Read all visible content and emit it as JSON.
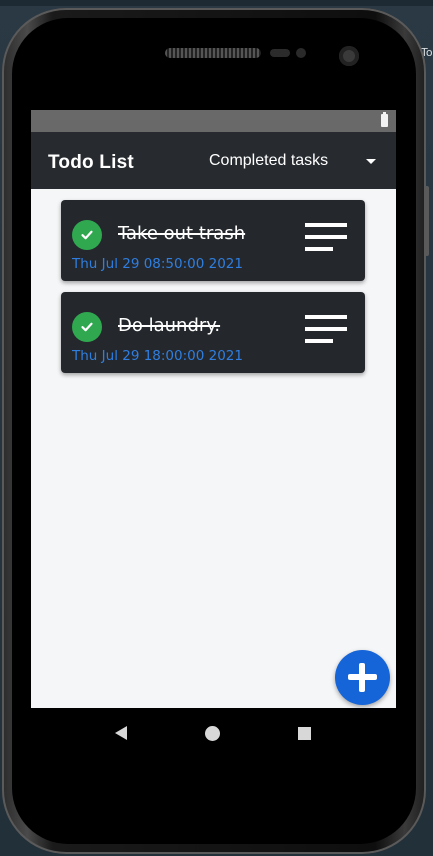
{
  "app": {
    "title": "Todo List",
    "filter": {
      "selected": "Completed tasks"
    }
  },
  "todos": [
    {
      "title": "Take out trash",
      "date": "Thu Jul 29 08:50:00 2021",
      "completed": true
    },
    {
      "title": "Do laundry.",
      "date": "Thu Jul 29 18:00:00 2021",
      "completed": true
    }
  ],
  "colors": {
    "app_bar": "#272b30",
    "card": "#24282d",
    "check": "#2fa84f",
    "date_text": "#2f7ee0",
    "fab": "#1565d8"
  },
  "icons": {
    "status": "battery-icon",
    "filter": "dropdown-caret-icon",
    "todo_status": "check-circle-icon",
    "todo_menu": "menu-lines-icon",
    "add": "plus-icon",
    "nav": [
      "back-icon",
      "home-icon",
      "recents-icon"
    ]
  },
  "desktop": {
    "side_label": "To"
  }
}
